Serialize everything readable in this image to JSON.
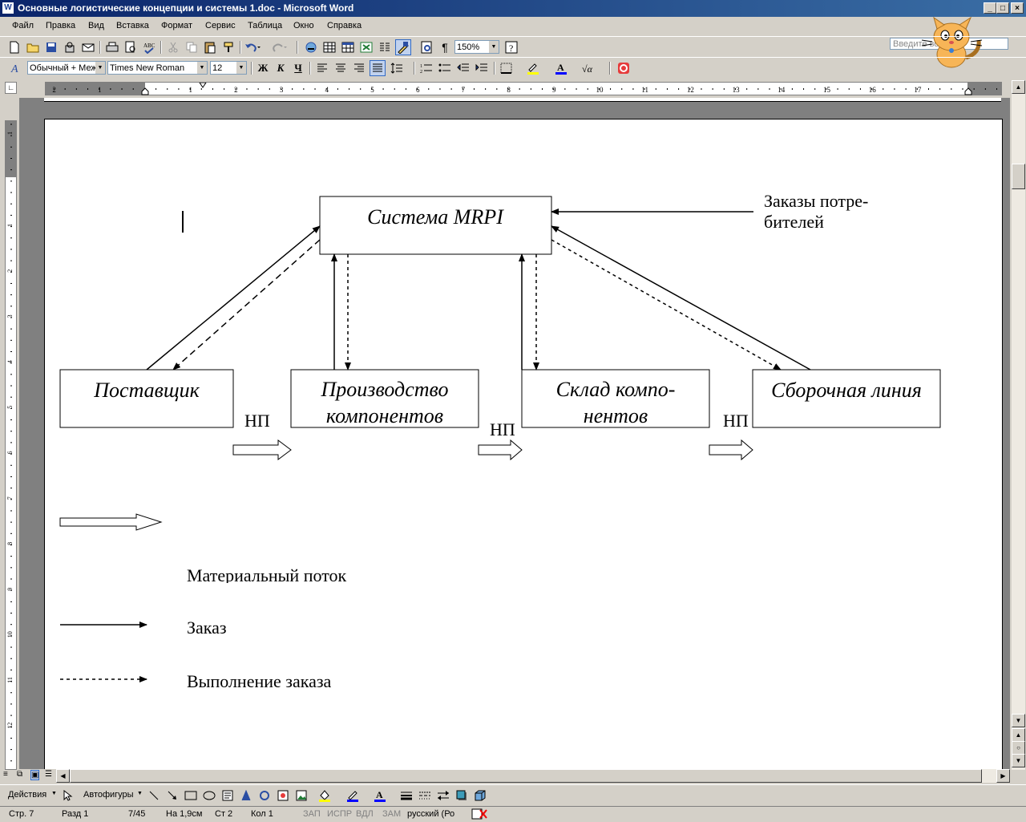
{
  "window": {
    "title": "Основные логистические концепции и системы 1.doc - Microsoft Word",
    "app_icon": "word-icon",
    "buttons": [
      "minimize",
      "maximize",
      "close"
    ]
  },
  "menu": {
    "items": [
      "Файл",
      "Правка",
      "Вид",
      "Вставка",
      "Формат",
      "Сервис",
      "Таблица",
      "Окно",
      "Справка"
    ],
    "ask_placeholder": "Введите вопрос"
  },
  "toolbar": {
    "zoom": "150%",
    "style": "Обычный + Меж",
    "font": "Times New Roman",
    "size": "12"
  },
  "ruler": {
    "h_labels": [
      "2",
      "1",
      "1",
      "2",
      "3",
      "4",
      "5",
      "6",
      "7",
      "8",
      "9",
      "10",
      "11",
      "12",
      "13",
      "14",
      "15",
      "16",
      "17"
    ],
    "v_labels": [
      "1",
      "1",
      "2",
      "3",
      "4",
      "5",
      "6",
      "7",
      "8",
      "9",
      "10",
      "11",
      "12",
      "13"
    ]
  },
  "diagram": {
    "mrpi": "Система MRPI",
    "orders_line1": "Заказы потре-",
    "orders_line2": "бителей",
    "supplier": "Поставщик",
    "production_line1": "Производство",
    "production_line2": "компонентов",
    "warehouse_line1": "Склад компо-",
    "warehouse_line2": "нентов",
    "assembly": "Сборочная линия",
    "np": "НП"
  },
  "legend": {
    "material_flow": "Материальный поток",
    "order": "Заказ",
    "fulfillment": "Выполнение заказа"
  },
  "drawing_toolbar": {
    "actions": "Действия",
    "autoshapes": "Автофигуры"
  },
  "status": {
    "page": "Стр. 7",
    "section": "Разд 1",
    "pages": "7/45",
    "at": "На 1,9см",
    "line": "Ст 2",
    "col": "Кол 1",
    "rec": "ЗАП",
    "trk": "ИСПР",
    "ext": "ВДЛ",
    "ovr": "ЗАМ",
    "lang": "русский (Ро"
  }
}
